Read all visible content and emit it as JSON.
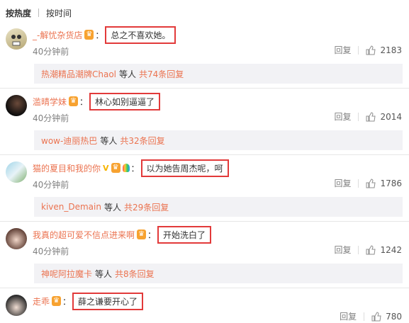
{
  "sort": {
    "hot": "按热度",
    "time": "按时间"
  },
  "comments": [
    {
      "user": "_-解忧杂货店",
      "badge": "♛",
      "colon": "：",
      "text": "总之不喜欢她。",
      "time": "40分钟前",
      "reply": "回复",
      "likes": "2183",
      "summary": {
        "name": "热潮精品潮牌Chaol",
        "mid": "等人",
        "count": "共74条回复"
      }
    },
    {
      "user": "滥晴学妹",
      "badge": "♛",
      "colon": "：",
      "text": "林心如别逼逼了",
      "time": "40分钟前",
      "reply": "回复",
      "likes": "2014",
      "summary": {
        "name": "wow-迪丽热巴",
        "mid": "等人",
        "count": "共32条回复"
      }
    },
    {
      "user": "猫的夏目和我的你",
      "vbadge": "V",
      "badge": "♛",
      "colon": "：",
      "text": "以为她告周杰呢，呵",
      "time": "40分钟前",
      "reply": "回复",
      "likes": "1786",
      "summary": {
        "name": "kiven_Demain",
        "mid": "等人",
        "count": "共29条回复"
      }
    },
    {
      "user": "我真的超可爱不信点进来啊",
      "badge": "♛",
      "colon": "：",
      "text": "开始洗白了",
      "time": "40分钟前",
      "reply": "回复",
      "likes": "1242",
      "summary": {
        "name": "神呢阿拉魔卡",
        "mid": "等人",
        "count": "共8条回复"
      }
    },
    {
      "user": "走乖",
      "badge": "♛",
      "colon": "：",
      "text": "薛之谦要开心了",
      "reply": "回复",
      "likes": "780"
    }
  ],
  "colors": {
    "accent": "#eb7350",
    "highlight_box": "#e23a3a",
    "summary_bg": "#f2f2f5"
  },
  "icons": {
    "like": "thumbs-up-icon",
    "badge": "crown-badge-icon",
    "v": "verified-v-icon",
    "bulb": "rainbow-bulb-icon"
  }
}
